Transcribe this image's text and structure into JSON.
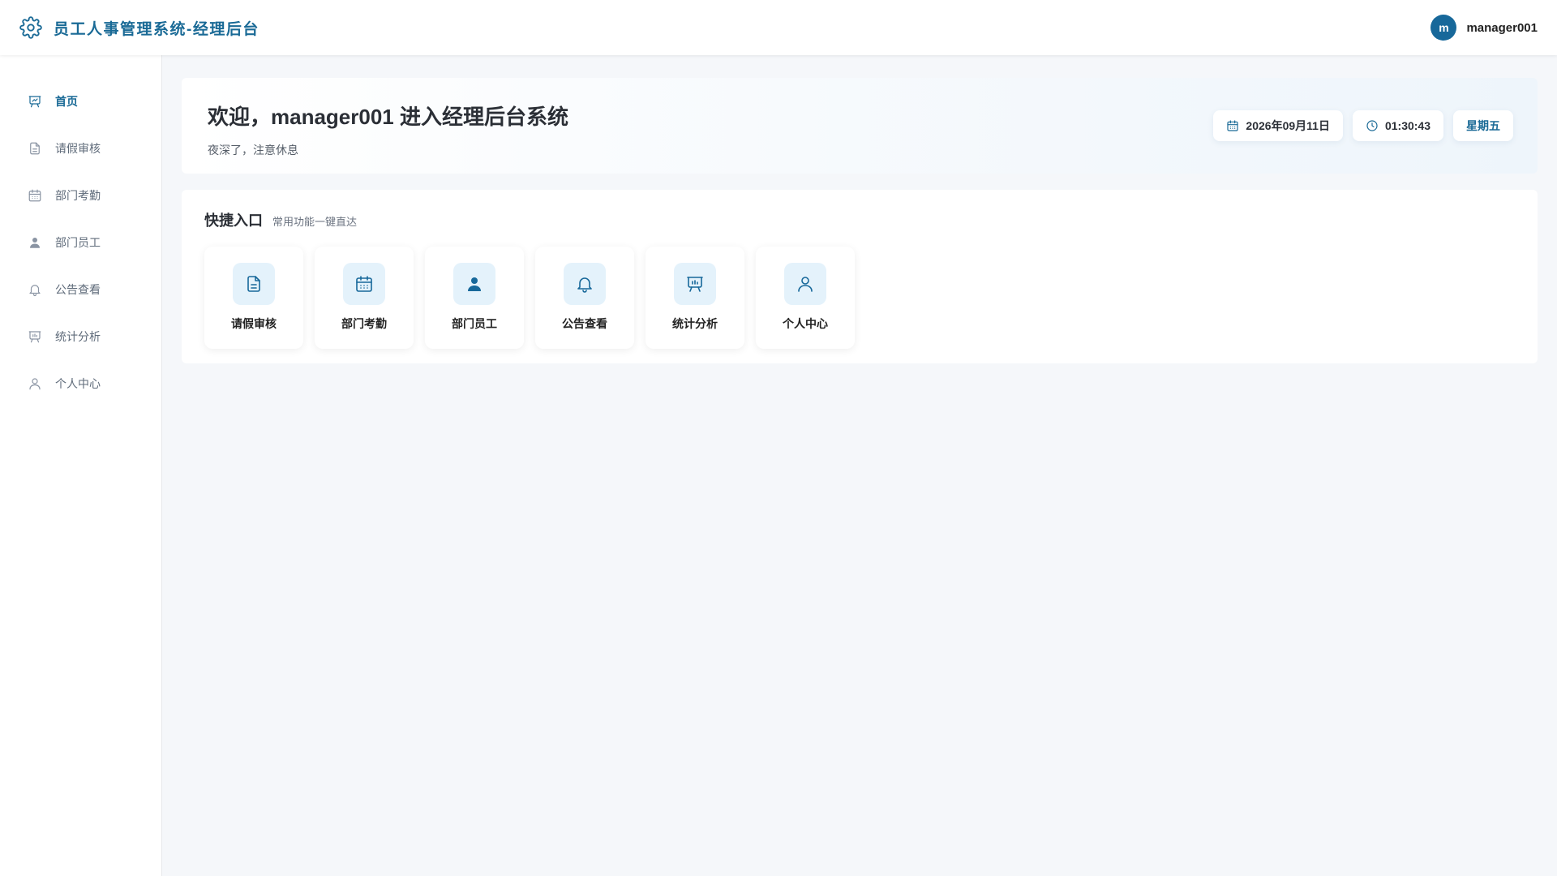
{
  "header": {
    "title": "员工人事管理系统-经理后台",
    "brand_icon": "gear-icon",
    "user": {
      "avatar_letter": "m",
      "name": "manager001"
    }
  },
  "sidebar": {
    "items": [
      {
        "label": "首页",
        "icon": "presentation-chart-icon",
        "active": true
      },
      {
        "label": "请假审核",
        "icon": "document-icon",
        "active": false
      },
      {
        "label": "部门考勤",
        "icon": "calendar-icon",
        "active": false
      },
      {
        "label": "部门员工",
        "icon": "user-solid-icon",
        "active": false
      },
      {
        "label": "公告查看",
        "icon": "bell-icon",
        "active": false
      },
      {
        "label": "统计分析",
        "icon": "presentation-chart-icon",
        "active": false
      },
      {
        "label": "个人中心",
        "icon": "user-outline-icon",
        "active": false
      }
    ]
  },
  "welcome": {
    "title": "欢迎，manager001 进入经理后台系统",
    "subtitle": "夜深了，注意休息",
    "date": "2026年09月11日",
    "time": "01:30:43",
    "weekday": "星期五"
  },
  "quick": {
    "title": "快捷入口",
    "subtitle": "常用功能一键直达",
    "tiles": [
      {
        "label": "请假审核",
        "icon": "document-icon"
      },
      {
        "label": "部门考勤",
        "icon": "calendar-icon"
      },
      {
        "label": "部门员工",
        "icon": "user-solid-icon"
      },
      {
        "label": "公告查看",
        "icon": "bell-icon"
      },
      {
        "label": "统计分析",
        "icon": "presentation-chart-icon"
      },
      {
        "label": "个人中心",
        "icon": "user-outline-icon"
      }
    ]
  },
  "colors": {
    "accent": "#1a6a96",
    "page_background": "#f5f7fa",
    "icon_tile_background": "#e4f2fb"
  }
}
